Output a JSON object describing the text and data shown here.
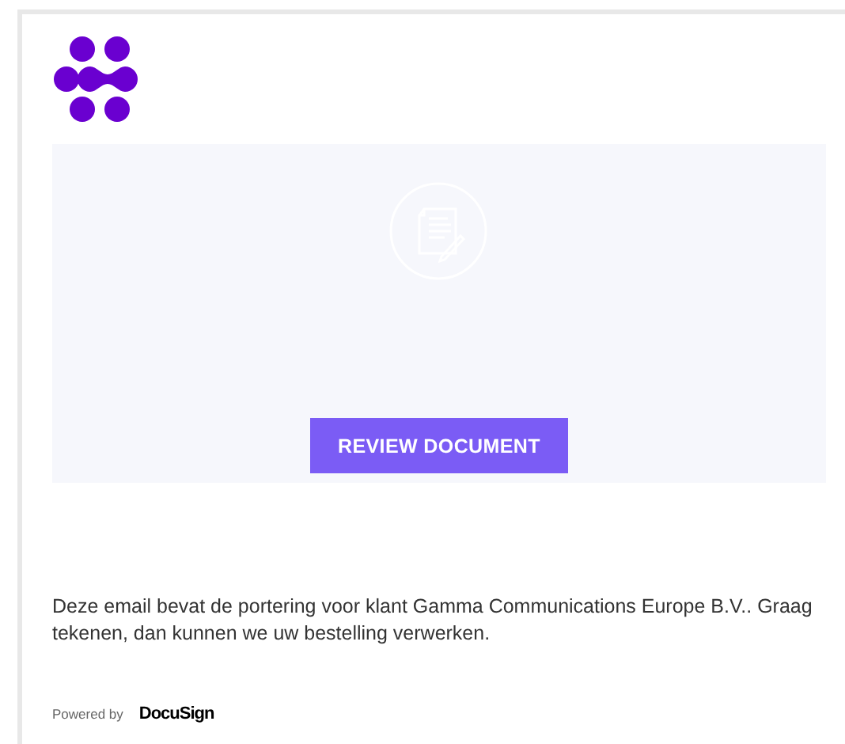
{
  "review_button": {
    "label": "REVIEW DOCUMENT"
  },
  "message": "Deze email bevat de portering voor klant Gamma Communications Europe B.V.. Graag tekenen, dan kunnen we uw bestelling verwerken.",
  "footer": {
    "powered_by": "Powered by",
    "brand": "DocuSign"
  }
}
